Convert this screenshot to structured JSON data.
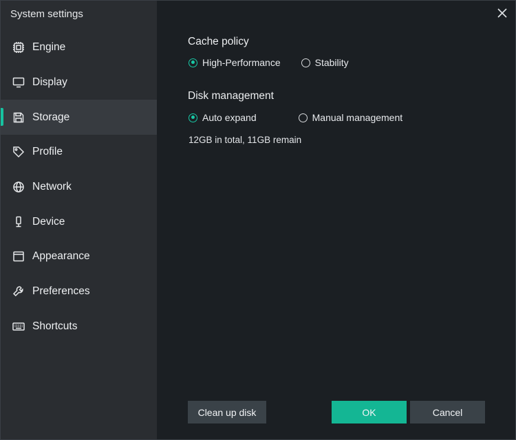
{
  "window": {
    "title": "System settings"
  },
  "sidebar": {
    "items": [
      {
        "label": "Engine",
        "icon": "chip-icon"
      },
      {
        "label": "Display",
        "icon": "monitor-icon"
      },
      {
        "label": "Storage",
        "icon": "save-icon",
        "active": true
      },
      {
        "label": "Profile",
        "icon": "tag-icon"
      },
      {
        "label": "Network",
        "icon": "globe-icon"
      },
      {
        "label": "Device",
        "icon": "microphone-icon"
      },
      {
        "label": "Appearance",
        "icon": "window-icon"
      },
      {
        "label": "Preferences",
        "icon": "wrench-icon"
      },
      {
        "label": "Shortcuts",
        "icon": "keyboard-icon"
      }
    ]
  },
  "cache_policy": {
    "title": "Cache policy",
    "options": [
      {
        "label": "High-Performance",
        "selected": true
      },
      {
        "label": "Stability",
        "selected": false
      }
    ]
  },
  "disk_management": {
    "title": "Disk management",
    "options": [
      {
        "label": "Auto expand",
        "selected": true
      },
      {
        "label": "Manual management",
        "selected": false
      }
    ],
    "info": "12GB in total, 11GB remain"
  },
  "buttons": {
    "cleanup": "Clean up disk",
    "ok": "OK",
    "cancel": "Cancel"
  },
  "colors": {
    "accent": "#17c3a1",
    "sidebar_bg": "#2a2d31",
    "content_bg": "#1b1f23",
    "button_gray": "#3a4248"
  }
}
